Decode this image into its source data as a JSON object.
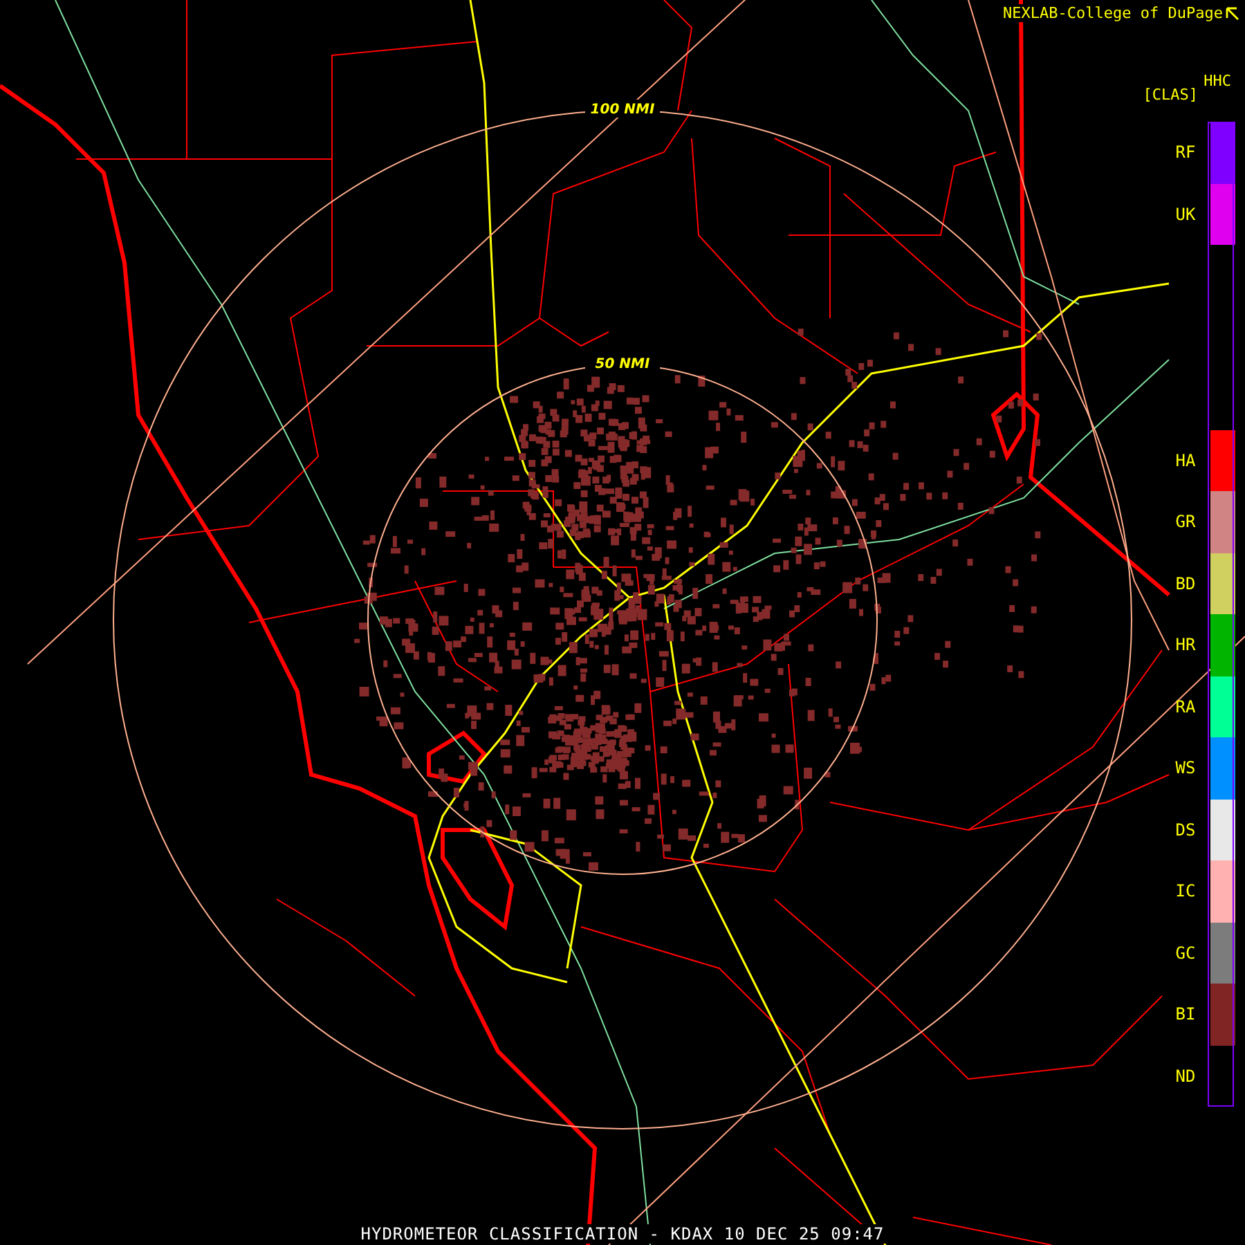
{
  "header": {
    "credit": "NEXLAB-College of DuPage",
    "product_code": "HHC",
    "product_type": "[CLAS]"
  },
  "map": {
    "range_rings": [
      {
        "label": "100 NMI"
      },
      {
        "label": "50 NMI"
      }
    ]
  },
  "legend": [
    {
      "kind": "class",
      "label": "RF",
      "color": "#7f00ff"
    },
    {
      "kind": "class",
      "label": "UK",
      "color": "#e000f0"
    },
    {
      "kind": "blank"
    },
    {
      "kind": "blank"
    },
    {
      "kind": "blank"
    },
    {
      "kind": "class",
      "label": "HA",
      "color": "#ff0000"
    },
    {
      "kind": "class",
      "label": "GR",
      "color": "#d08484"
    },
    {
      "kind": "class",
      "label": "BD",
      "color": "#d0d060"
    },
    {
      "kind": "class",
      "label": "HR",
      "color": "#00b400"
    },
    {
      "kind": "class",
      "label": "RA",
      "color": "#00ff94"
    },
    {
      "kind": "class",
      "label": "WS",
      "color": "#0090ff"
    },
    {
      "kind": "class",
      "label": "DS",
      "color": "#e8e8e8"
    },
    {
      "kind": "class",
      "label": "IC",
      "color": "#ffb0b0"
    },
    {
      "kind": "class",
      "label": "GC",
      "color": "#7c7c7c"
    },
    {
      "kind": "class",
      "label": "BI",
      "color": "#802424"
    },
    {
      "kind": "class",
      "label": "ND",
      "color": "#000000"
    }
  ],
  "footer": {
    "title": "HYDROMETEOR CLASSIFICATION - KDAX 10 DEC 25 09:47"
  }
}
